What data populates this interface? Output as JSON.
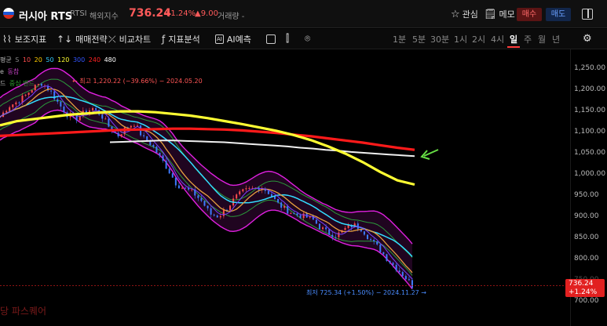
{
  "header": {
    "title": "러시아 RTS",
    "symbol": "RTSI",
    "category": "해외지수",
    "price": "736.24",
    "change_pct": "+1.24%",
    "change_abs": "▲9.00",
    "volume": "거래량 -",
    "watch_label": "관심",
    "memo_label": "메모",
    "buy_label": "매수",
    "sell_label": "매도"
  },
  "toolbar": {
    "indicators": "보조지표",
    "strategy": "매매전략",
    "compare": "비교차트",
    "analysis": "지표분석",
    "ai_prediction": "AI예측",
    "ai_badge": "AI",
    "timeframes": [
      "1분",
      "5분",
      "30분",
      "1시",
      "2시",
      "4시",
      "일",
      "주",
      "월",
      "년"
    ],
    "active_timeframe": "일"
  },
  "legend": {
    "ma_title": "평균",
    "ma_label": "S",
    "ma_periods": [
      "10",
      "20",
      "50",
      "120",
      "300",
      "240",
      "480"
    ],
    "ma_colors": [
      "#ff4d4d",
      "#ffcc00",
      "#33ccff",
      "#ffff33",
      "#3355ff",
      "#ff2222",
      "#ffffff"
    ],
    "line2_a": "e",
    "line2_b": "동참",
    "line3_a": "드",
    "line3_b": "중심 밴드"
  },
  "annotations": {
    "high": "← 최고 1,220.22 (−39.66%) − 2024.05.20",
    "low": "최저 725.34 (+1.50%) − 2024.11.27 →"
  },
  "axis": {
    "ticks": [
      "1,250.00",
      "1,200.00",
      "1,150.00",
      "1,100.00",
      "1,050.00",
      "1,000.00",
      "950.00",
      "900.00",
      "850.00",
      "800.00",
      "750.00",
      "700.00"
    ],
    "last_price": "736.24",
    "last_pct": "+1.24%"
  },
  "brand": "당 파스퀘어",
  "colors": {
    "up": "#ff4d4d",
    "down": "#3d7bff",
    "band": "#e020e0",
    "ma120": "#ffff33",
    "ma240": "#ff1a1a",
    "ma480": "#f0f0f0",
    "ma50": "#33ddff",
    "ma20": "#e8a040",
    "arrow": "#66dd44"
  },
  "chart_data": {
    "type": "line",
    "y_axis_range": [
      700,
      1250
    ],
    "close_series_approx": [
      1135,
      1160,
      1170,
      1185,
      1205,
      1215,
      1195,
      1165,
      1140,
      1130,
      1145,
      1155,
      1140,
      1110,
      1090,
      1110,
      1120,
      1085,
      1070,
      1040,
      1010,
      975,
      965,
      955,
      935,
      905,
      900,
      920,
      945,
      960,
      965,
      970,
      955,
      930,
      915,
      905,
      900,
      895,
      875,
      860,
      855,
      870,
      880,
      870,
      845,
      825,
      800,
      780,
      760,
      736
    ],
    "ma120_approx": [
      1115,
      1125,
      1130,
      1135,
      1140,
      1143,
      1146,
      1148,
      1148,
      1146,
      1142,
      1138,
      1132,
      1125,
      1118,
      1110,
      1102,
      1092,
      1080,
      1065,
      1048,
      1028,
      1005,
      985,
      975
    ],
    "ma240_approx": [
      1090,
      1092,
      1094,
      1096,
      1098,
      1100,
      1102,
      1104,
      1105,
      1106,
      1107,
      1107,
      1106,
      1105,
      1103,
      1100,
      1097,
      1093,
      1089,
      1084,
      1079,
      1074,
      1068,
      1062,
      1057
    ],
    "ma480_approx": [
      1075,
      1076,
      1077,
      1078,
      1079,
      1079,
      1078,
      1077,
      1076,
      1075,
      1073,
      1071,
      1069,
      1067,
      1065,
      1062,
      1060,
      1057,
      1055,
      1052,
      1050,
      1048,
      1046,
      1044,
      1042
    ],
    "high": 1220.22,
    "low": 725.34
  }
}
